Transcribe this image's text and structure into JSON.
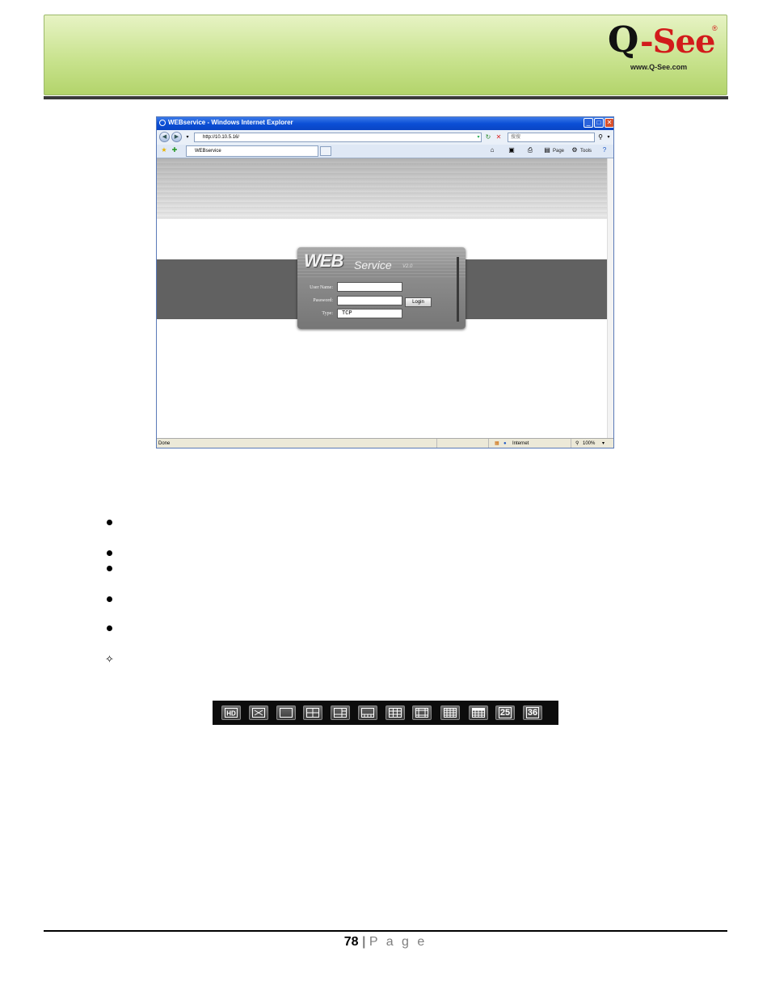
{
  "header": {
    "logo_q": "Q",
    "logo_dash_see": "-See",
    "logo_reg": "®",
    "logo_url": "www.Q-See.com"
  },
  "browser": {
    "title": "WEBservice - Windows Internet Explorer",
    "address": "http://10.10.5.16/",
    "search_placeholder": "搜搜",
    "tab_label": "WEBservice",
    "cmd_page": "Page",
    "cmd_tools": "Tools",
    "status_left": "Done",
    "status_zone": "Internet",
    "status_zoom": "100%"
  },
  "login": {
    "logo_web": "WEB",
    "logo_service": "Service",
    "logo_version": "V2.0",
    "username_label": "User Name:",
    "password_label": "Password:",
    "type_label": "Type:",
    "type_value": "TCP",
    "login_button": "Login"
  },
  "toolbar": {
    "buttons": [
      "hd-icon",
      "fullscreen-icon",
      "layout-1-icon",
      "layout-4-icon",
      "layout-6-icon",
      "layout-8-icon",
      "layout-9-icon",
      "layout-13-icon",
      "layout-16-icon",
      "layout-20-icon",
      "layout-25",
      "layout-36"
    ],
    "label_25": "25",
    "label_36": "36",
    "label_hd": "HD"
  },
  "footer": {
    "page_number": "78",
    "separator": "|",
    "page_word": "P a g e"
  }
}
